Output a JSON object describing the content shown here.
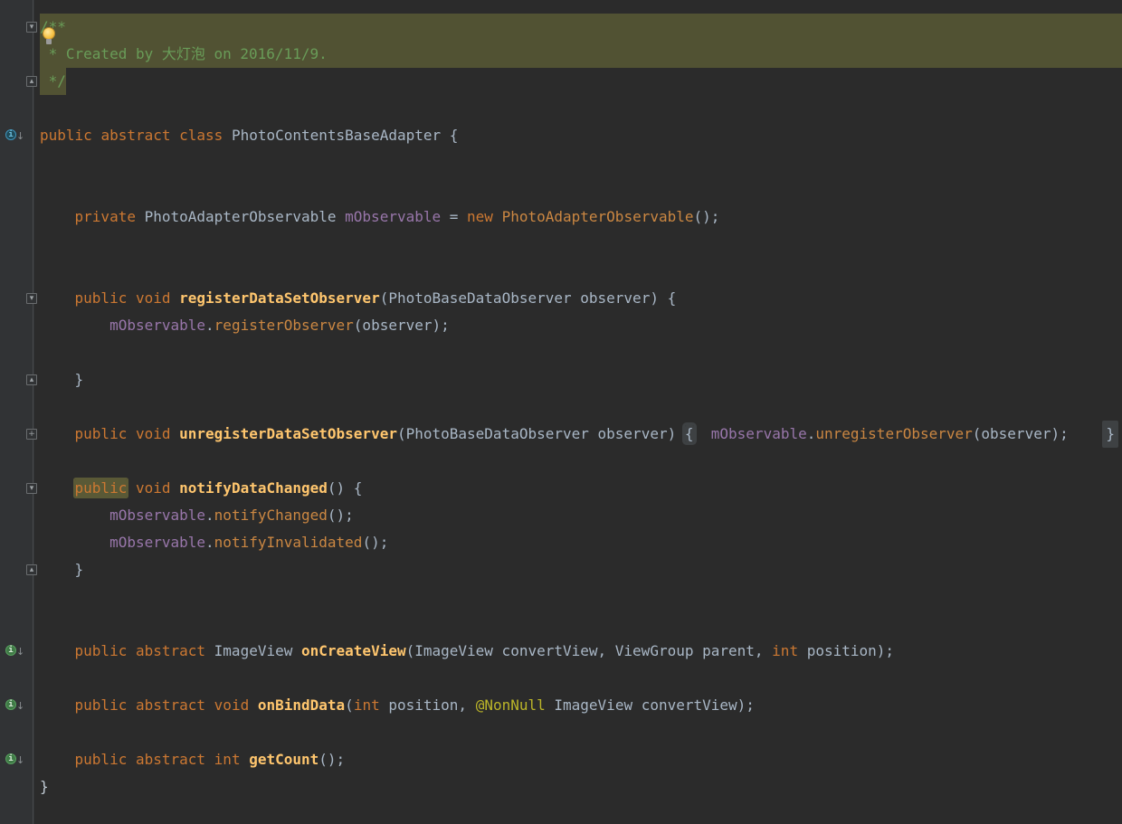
{
  "app": {
    "description": "IntelliJ IDEA Darcula editor showing PhotoContentsBaseAdapter.java",
    "language": "Java"
  },
  "colors": {
    "editor_background": "#2b2b2b",
    "gutter_background": "#313335",
    "selection_highlight": "#515233",
    "identifier_highlight": "#5a5936",
    "keyword": "#cc7832",
    "default_text": "#a9b7c6",
    "field": "#9876aa",
    "method_declaration": "#ffc66e",
    "method_call": "#cb8742",
    "comment": "#699c58",
    "annotation": "#bbb529",
    "folded_chip_background": "#3e4143",
    "matched_brace": "#c2ccd6"
  },
  "icons": [
    {
      "name": "intention-lightbulb-icon",
      "meaning": "intention action available"
    },
    {
      "name": "implemented-class-icon",
      "meaning": "class is implemented/subclassed"
    },
    {
      "name": "implemented-method-icon",
      "meaning": "abstract method is implemented"
    },
    {
      "name": "fold-open-icon",
      "meaning": "collapse region"
    },
    {
      "name": "fold-end-icon",
      "meaning": "end of foldable region"
    },
    {
      "name": "fold-plus-icon",
      "meaning": "expand folded region"
    }
  ],
  "editor": {
    "lines": [
      {
        "sel": "full",
        "fold": "open",
        "bulb": true,
        "tokens": [
          [
            "cm",
            "/**"
          ]
        ]
      },
      {
        "sel": "full",
        "tokens": [
          [
            "cm",
            " * Created by 大灯泡 on 2016/11/9."
          ]
        ]
      },
      {
        "sel": "text",
        "fold": "end",
        "tokens": [
          [
            "cm",
            " */"
          ]
        ]
      },
      {
        "tokens": []
      },
      {
        "mark": "impl-class",
        "tokens": [
          [
            "k",
            "public"
          ],
          [
            "d",
            " "
          ],
          [
            "k",
            "abstract"
          ],
          [
            "d",
            " "
          ],
          [
            "k",
            "class"
          ],
          [
            "d",
            " PhotoContentsBaseAdapter {"
          ]
        ]
      },
      {
        "tokens": []
      },
      {
        "tokens": []
      },
      {
        "tokens": [
          [
            "d",
            "    "
          ],
          [
            "k",
            "private"
          ],
          [
            "d",
            " PhotoAdapterObservable "
          ],
          [
            "f",
            "mObservable"
          ],
          [
            "d",
            " = "
          ],
          [
            "k",
            "new"
          ],
          [
            "d",
            " "
          ],
          [
            "c",
            "PhotoAdapterObservable"
          ],
          [
            "d",
            "();"
          ]
        ]
      },
      {
        "tokens": []
      },
      {
        "tokens": []
      },
      {
        "fold": "open",
        "tokens": [
          [
            "d",
            "    "
          ],
          [
            "k",
            "public"
          ],
          [
            "d",
            " "
          ],
          [
            "k",
            "void"
          ],
          [
            "d",
            " "
          ],
          [
            "m",
            "registerDataSetObserver"
          ],
          [
            "d",
            "(PhotoBaseDataObserver observer) {"
          ]
        ]
      },
      {
        "tokens": [
          [
            "d",
            "        "
          ],
          [
            "f",
            "mObservable"
          ],
          [
            "d",
            "."
          ],
          [
            "c",
            "registerObserver"
          ],
          [
            "d",
            "(observer);"
          ]
        ]
      },
      {
        "tokens": []
      },
      {
        "fold": "end",
        "tokens": [
          [
            "d",
            "    }"
          ]
        ]
      },
      {
        "tokens": []
      },
      {
        "fold": "plus",
        "foldedRight": "}",
        "tokens": [
          [
            "d",
            "    "
          ],
          [
            "k",
            "public"
          ],
          [
            "d",
            " "
          ],
          [
            "k",
            "void"
          ],
          [
            "d",
            " "
          ],
          [
            "m",
            "unregisterDataSetObserver"
          ],
          [
            "d",
            "(PhotoBaseDataObserver observer) "
          ],
          [
            "chip",
            "{"
          ],
          [
            "d",
            "  "
          ],
          [
            "f",
            "mObservable"
          ],
          [
            "d",
            "."
          ],
          [
            "c",
            "unregisterObserver"
          ],
          [
            "d",
            "(observer);"
          ]
        ]
      },
      {
        "tokens": []
      },
      {
        "fold": "open",
        "tokens": [
          [
            "d",
            "    "
          ],
          [
            "k hl",
            "public"
          ],
          [
            "d",
            " "
          ],
          [
            "k",
            "void"
          ],
          [
            "d",
            " "
          ],
          [
            "m",
            "notifyDataChanged"
          ],
          [
            "d",
            "() {"
          ]
        ]
      },
      {
        "tokens": [
          [
            "d",
            "        "
          ],
          [
            "f",
            "mObservable"
          ],
          [
            "d",
            "."
          ],
          [
            "c",
            "notifyChanged"
          ],
          [
            "d",
            "();"
          ]
        ]
      },
      {
        "tokens": [
          [
            "d",
            "        "
          ],
          [
            "f",
            "mObservable"
          ],
          [
            "d",
            "."
          ],
          [
            "c",
            "notifyInvalidated"
          ],
          [
            "d",
            "();"
          ]
        ]
      },
      {
        "fold": "end",
        "tokens": [
          [
            "d",
            "    }"
          ]
        ]
      },
      {
        "tokens": []
      },
      {
        "tokens": []
      },
      {
        "mark": "impl-method",
        "tokens": [
          [
            "d",
            "    "
          ],
          [
            "k",
            "public"
          ],
          [
            "d",
            " "
          ],
          [
            "k",
            "abstract"
          ],
          [
            "d",
            " ImageView "
          ],
          [
            "m",
            "onCreateView"
          ],
          [
            "d",
            "(ImageView convertView, ViewGroup parent, "
          ],
          [
            "k",
            "int"
          ],
          [
            "d",
            " position);"
          ]
        ]
      },
      {
        "tokens": []
      },
      {
        "mark": "impl-method",
        "tokens": [
          [
            "d",
            "    "
          ],
          [
            "k",
            "public"
          ],
          [
            "d",
            " "
          ],
          [
            "k",
            "abstract"
          ],
          [
            "d",
            " "
          ],
          [
            "k",
            "void"
          ],
          [
            "d",
            " "
          ],
          [
            "m",
            "onBindData"
          ],
          [
            "d",
            "("
          ],
          [
            "k",
            "int"
          ],
          [
            "d",
            " position, "
          ],
          [
            "an",
            "@NonNull"
          ],
          [
            "d",
            " ImageView convertView);"
          ]
        ]
      },
      {
        "tokens": []
      },
      {
        "mark": "impl-method",
        "tokens": [
          [
            "d",
            "    "
          ],
          [
            "k",
            "public"
          ],
          [
            "d",
            " "
          ],
          [
            "k",
            "abstract"
          ],
          [
            "d",
            " "
          ],
          [
            "k",
            "int"
          ],
          [
            "d",
            " "
          ],
          [
            "m",
            "getCount"
          ],
          [
            "d",
            "();"
          ]
        ]
      },
      {
        "tokens": [
          [
            "hb",
            "}"
          ]
        ]
      }
    ]
  }
}
